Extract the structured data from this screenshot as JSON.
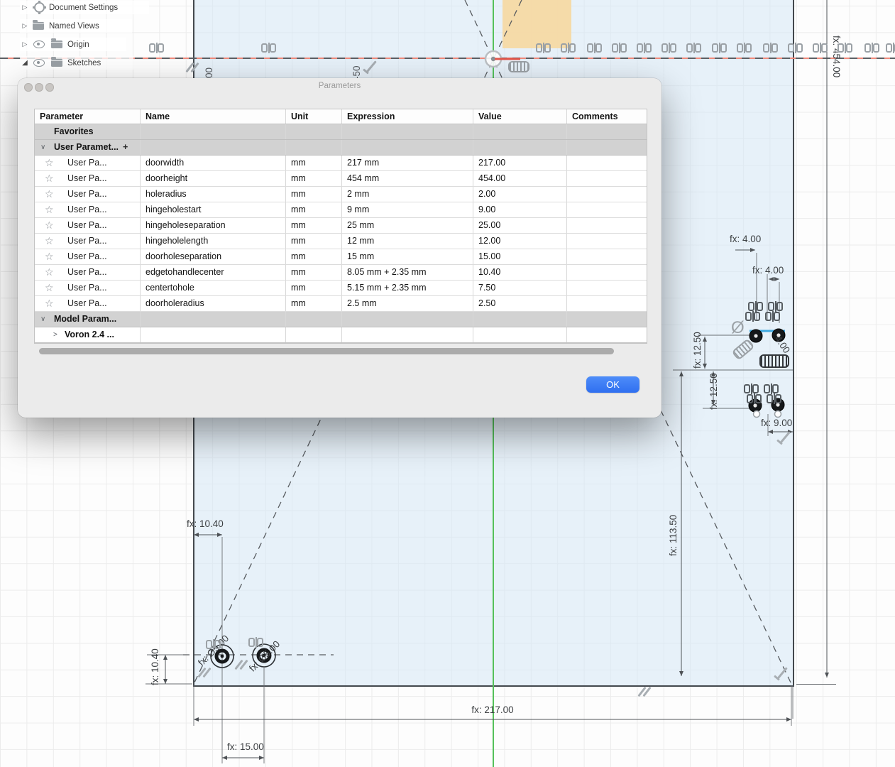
{
  "tree": {
    "items": [
      {
        "label": "Document Settings"
      },
      {
        "label": "Named Views"
      },
      {
        "label": "Origin"
      },
      {
        "label": "Sketches"
      }
    ]
  },
  "dialog": {
    "title": "Parameters",
    "columns": {
      "parameter": "Parameter",
      "name": "Name",
      "unit": "Unit",
      "expression": "Expression",
      "value": "Value",
      "comments": "Comments"
    },
    "sections": {
      "favorites": "Favorites",
      "user": "User Paramet...",
      "model": "Model Param...",
      "voron": "Voron 2.4 ..."
    },
    "row_label": "User Pa...",
    "rows": [
      {
        "name": "doorwidth",
        "unit": "mm",
        "expression": "217 mm",
        "value": "217.00"
      },
      {
        "name": "doorheight",
        "unit": "mm",
        "expression": "454 mm",
        "value": "454.00"
      },
      {
        "name": "holeradius",
        "unit": "mm",
        "expression": "2 mm",
        "value": "2.00"
      },
      {
        "name": "hingeholestart",
        "unit": "mm",
        "expression": "9 mm",
        "value": "9.00"
      },
      {
        "name": "hingeholeseparation",
        "unit": "mm",
        "expression": "25 mm",
        "value": "25.00"
      },
      {
        "name": "hingeholelength",
        "unit": "mm",
        "expression": "12 mm",
        "value": "12.00"
      },
      {
        "name": "doorholeseparation",
        "unit": "mm",
        "expression": "15 mm",
        "value": "15.00"
      },
      {
        "name": "edgetohandlecenter",
        "unit": "mm",
        "expression": "8.05 mm + 2.35 mm",
        "value": "10.40"
      },
      {
        "name": "centertohole",
        "unit": "mm",
        "expression": "5.15 mm + 2.35 mm",
        "value": "7.50"
      },
      {
        "name": "doorholeradius",
        "unit": "mm",
        "expression": "2.5 mm",
        "value": "2.50"
      }
    ],
    "ok_label": "OK",
    "accent_color": "#3a7df5"
  },
  "canvas": {
    "dim_labels": {
      "door_height": "fx: 454.00",
      "door_width": "fx: 217.00",
      "corner_diag": "fx: 113.50",
      "hinge_offset_a": "fx: 4.00",
      "hinge_offset_b": "fx: 4.00",
      "hinge_sep_a": "fx: 12.50",
      "hinge_sep_b": "fx: 12.50",
      "hinge_start": "fx: 9.00",
      "handle_edge": "fx: 10.40",
      "handle_height": "fx: 10.40",
      "handle_sep": "fx: 15.00",
      "handle_dia_a": "fx: Ø5.00",
      "handle_dia_b": "fx: Ø5.00",
      "hinge_dia_fragment": "4.00",
      "dia_symbol": "Ø"
    },
    "axis_labels": {
      "x_minus_100_fragment": "00",
      "x_minus_50": "-50"
    },
    "colors": {
      "y_axis": "#55c15a",
      "x_axis": "#ef8a7c",
      "door_fill": "#e7f1f9",
      "highlight_rect": "#f6d9a4",
      "selected_edge_blue": "#3fa9e0"
    }
  }
}
